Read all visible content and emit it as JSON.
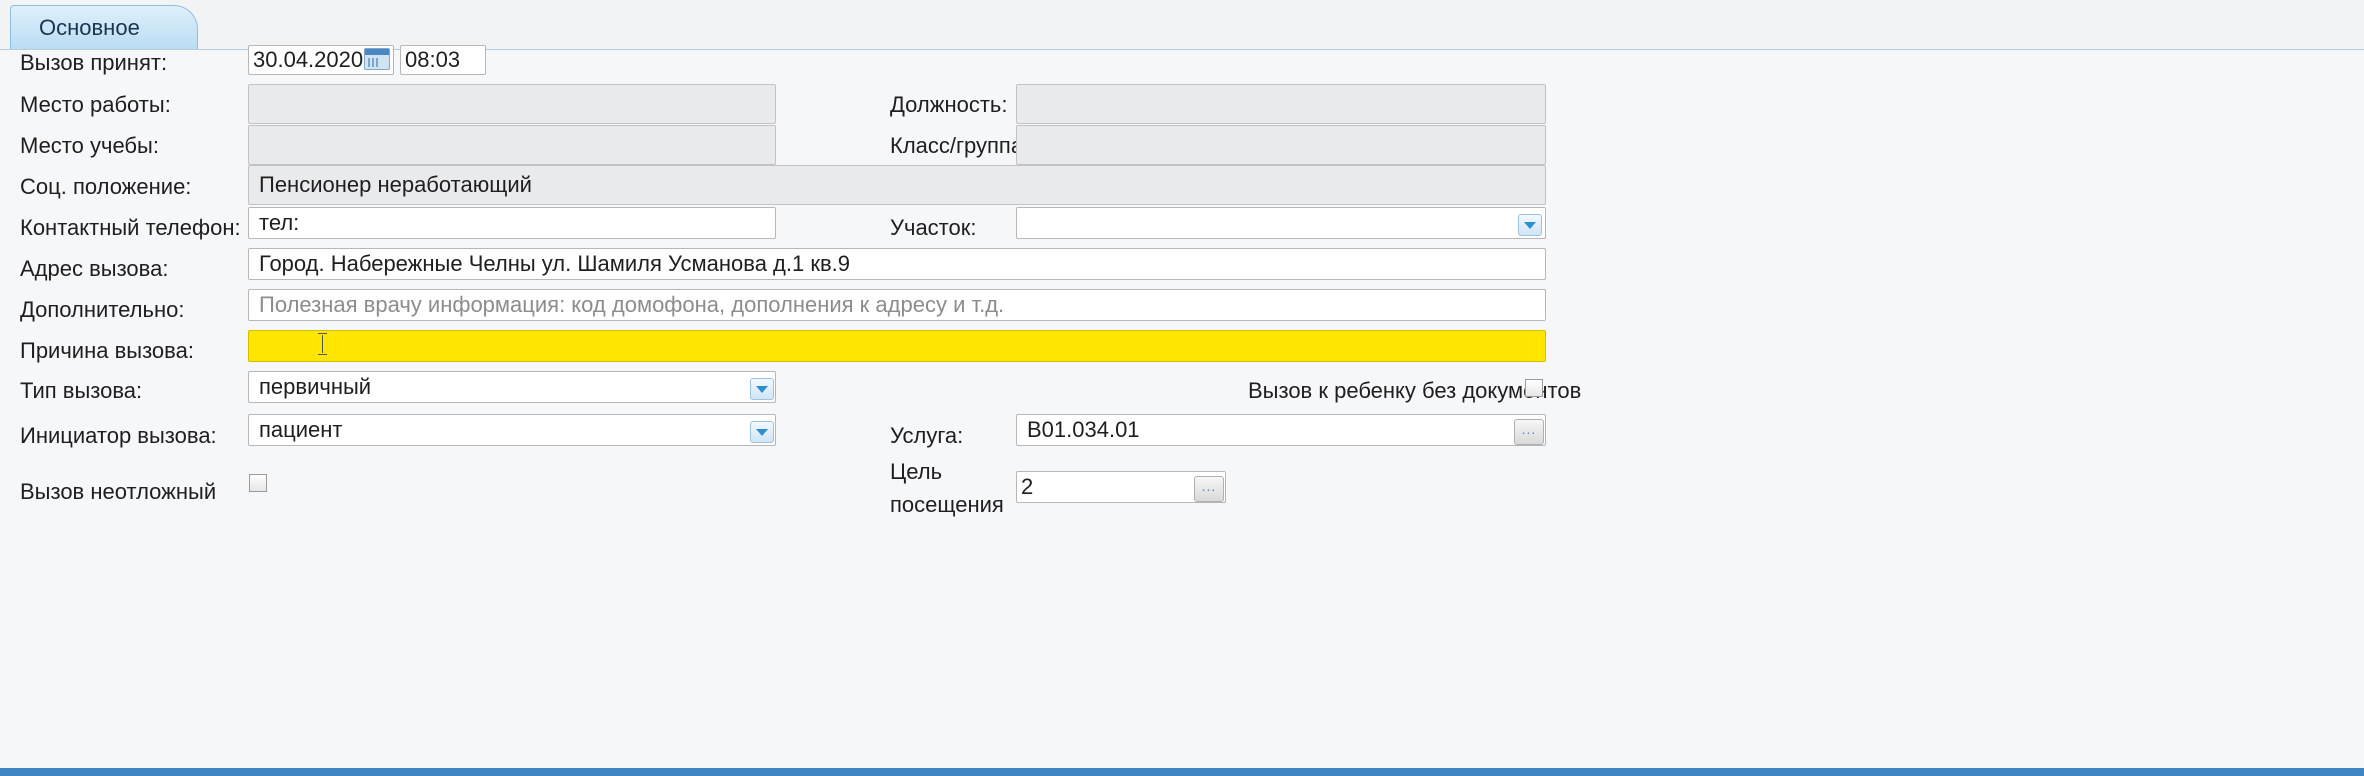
{
  "tabs": [
    {
      "label": "Основное",
      "active": true
    }
  ],
  "form": {
    "call_accepted": {
      "label": "Вызов принят:",
      "date": "30.04.2020",
      "time": "08:03"
    },
    "workplace": {
      "label": "Место работы:",
      "value": ""
    },
    "position": {
      "label": "Должность:",
      "value": ""
    },
    "study_place": {
      "label": "Место учебы:",
      "value": ""
    },
    "class_group": {
      "label": "Класс/группа:",
      "value": ""
    },
    "social_status": {
      "label": "Соц. положение:",
      "value": "Пенсионер неработающий"
    },
    "contact_phone": {
      "label": "Контактный телефон:",
      "value": "тел:"
    },
    "district": {
      "label": "Участок:",
      "value": ""
    },
    "call_address": {
      "label": "Адрес вызова:",
      "value": "Город. Набережные Челны ул. Шамиля Усманова д.1 кв.9"
    },
    "additional": {
      "label": "Дополнительно:",
      "value": "",
      "placeholder": "Полезная врачу информация: код домофона, дополнения к адресу и т.д."
    },
    "call_reason": {
      "label": "Причина вызова:",
      "value": "",
      "highlight_color": "#ffe600"
    },
    "call_type": {
      "label": "Тип вызова:",
      "value": "первичный"
    },
    "child_without_docs": {
      "label": "Вызов к ребенку без документов",
      "checked": false
    },
    "call_initiator": {
      "label": "Инициатор вызова:",
      "value": "пациент"
    },
    "service": {
      "label": "Услуга:",
      "value": "B01.034.01"
    },
    "non_urgent": {
      "label": "Вызов неотложный",
      "checked": false
    },
    "visit_purpose": {
      "label_line1": "Цель",
      "label_line2": "посещения",
      "value": "2"
    }
  },
  "colors": {
    "accent": "#3f85c4",
    "required_field": "#ffe600",
    "disabled_field": "#e9eaeb"
  },
  "icons": [
    "calendar-icon",
    "dropdown-arrow-icon",
    "ellipsis-icon",
    "text-cursor-icon"
  ]
}
